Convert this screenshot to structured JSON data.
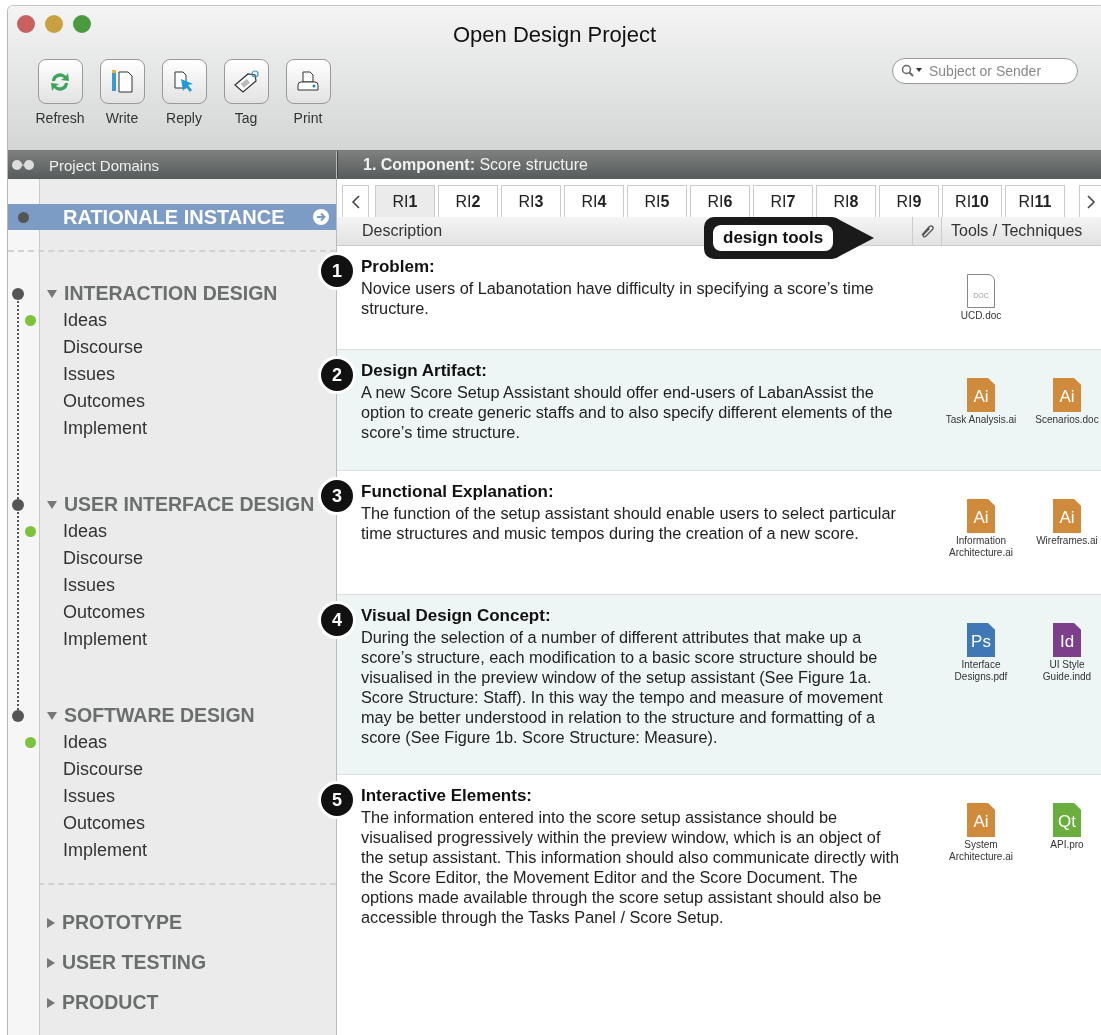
{
  "window": {
    "title": "Open Design Project"
  },
  "toolbar": [
    {
      "kind": "refresh",
      "label": "Refresh"
    },
    {
      "kind": "write",
      "label": "Write"
    },
    {
      "kind": "reply",
      "label": "Reply"
    },
    {
      "kind": "tag",
      "label": "Tag"
    },
    {
      "kind": "print",
      "label": "Print"
    }
  ],
  "search": {
    "placeholder": "Subject or Sender"
  },
  "sidebar": {
    "header": "Project Domains",
    "instance": {
      "label": "RATIONALE INSTANCE",
      "selected": true
    },
    "domains": [
      {
        "label": "INTERACTION DESIGN",
        "expanded": true,
        "items": [
          {
            "label": "Ideas",
            "selected": true
          },
          {
            "label": "Discourse",
            "selected": false
          },
          {
            "label": "Issues",
            "selected": false
          },
          {
            "label": "Outcomes",
            "selected": false
          },
          {
            "label": "Implement",
            "selected": false
          }
        ]
      },
      {
        "label": "USER INTERFACE DESIGN",
        "expanded": true,
        "items": [
          {
            "label": "Ideas",
            "selected": true
          },
          {
            "label": "Discourse",
            "selected": false
          },
          {
            "label": "Issues",
            "selected": false
          },
          {
            "label": "Outcomes",
            "selected": false
          },
          {
            "label": "Implement",
            "selected": false
          }
        ]
      },
      {
        "label": "SOFTWARE DESIGN",
        "expanded": true,
        "items": [
          {
            "label": "Ideas",
            "selected": true
          },
          {
            "label": "Discourse",
            "selected": false
          },
          {
            "label": "Issues",
            "selected": false
          },
          {
            "label": "Outcomes",
            "selected": false
          },
          {
            "label": "Implement",
            "selected": false
          }
        ]
      },
      {
        "label": "PROTOTYPE",
        "expanded": false
      },
      {
        "label": "USER TESTING",
        "expanded": false
      },
      {
        "label": "PRODUCT",
        "expanded": false
      }
    ]
  },
  "content": {
    "heading": "**1. Component:** Score structure",
    "tabs": [
      {
        "label": "RI**1**",
        "selected": true
      },
      {
        "label": "RI**2**",
        "selected": false
      },
      {
        "label": "RI**3**",
        "selected": false
      },
      {
        "label": "RI**4**",
        "selected": false
      },
      {
        "label": "RI**5**",
        "selected": false
      },
      {
        "label": "RI**6**",
        "selected": false
      },
      {
        "label": "RI**7**",
        "selected": false
      },
      {
        "label": "RI**8**",
        "selected": false
      },
      {
        "label": "RI**9**",
        "selected": false
      },
      {
        "label": "RI**10**",
        "selected": false
      },
      {
        "label": "RI**11**",
        "selected": false
      }
    ],
    "columns": [
      "Description",
      "Tools / Techniques"
    ],
    "callout": "design tools",
    "rows": [
      {
        "number": "1",
        "title": "Problem:",
        "text": "Novice users of Labanotation have difficulty in specifying a score’s time structure.",
        "files": [
          {
            "kind": "doc",
            "badge": "DOC",
            "name": "UCD.doc"
          }
        ]
      },
      {
        "number": "2",
        "title": "Design Artifact:",
        "text": "A new Score Setup Assistant should offer end-users of LabanAssist the option to create generic staffs and to also specify different elements of the score’s time structure.",
        "files": [
          {
            "kind": "ai",
            "badge": "Ai",
            "name": "Task Analysis.ai"
          },
          {
            "kind": "ai",
            "badge": "Ai",
            "name": "Scenarios.doc"
          }
        ]
      },
      {
        "number": "3",
        "title": "Functional Explanation:",
        "text": "The function of the setup assistant should enable users to select particular time structures and music tempos during the creation of a new score.",
        "files": [
          {
            "kind": "ai",
            "badge": "Ai",
            "name": "Information Architecture.ai"
          },
          {
            "kind": "ai",
            "badge": "Ai",
            "name": "Wireframes.ai"
          }
        ]
      },
      {
        "number": "4",
        "title": "Visual Design Concept:",
        "text": "During the selection of a number of different attributes that make up a score’s structure, each modification to a basic score structure should be visualised in the preview window of the setup assistant (See Figure 1a. Score Structure: Staff). In this way the tempo and measure of movement may be better understood in relation to the structure and formatting of a score (See Figure 1b. Score Structure: Measure).",
        "files": [
          {
            "kind": "ps",
            "badge": "Ps",
            "name": "Interface Designs.pdf"
          },
          {
            "kind": "id",
            "badge": "Id",
            "name": "UI Style Guide.indd"
          }
        ]
      },
      {
        "number": "5",
        "title": "Interactive Elements:",
        "text": "The information entered into the score setup assistance should be visualised progressively within the preview window, which is an object of the setup assistant. This information should also communicate directly with the Score Editor, the Movement Editor and the Score Document. The options made available through the score setup assistant should also be accessible through the Tasks Panel / Score Setup.",
        "files": [
          {
            "kind": "ai",
            "badge": "Ai",
            "name": "System Architecture.ai"
          },
          {
            "kind": "qt",
            "badge": "Qt",
            "name": "API.pro"
          }
        ]
      }
    ]
  }
}
